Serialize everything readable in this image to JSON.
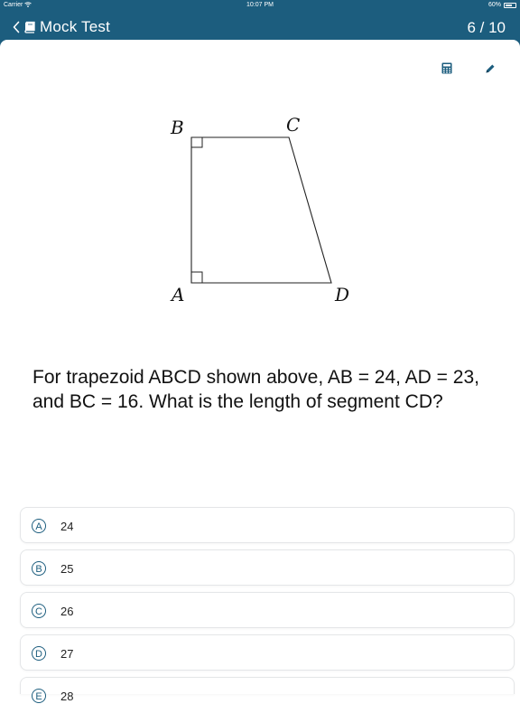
{
  "status": {
    "carrier": "Carrier",
    "time": "10:07 PM",
    "battery": "60%"
  },
  "header": {
    "title": "Mock Test",
    "progress": "6 / 10",
    "color": "#1c5d7e"
  },
  "toolbar": {
    "calculator_icon": "calculator-icon",
    "pencil_icon": "pencil-icon"
  },
  "figure": {
    "labels": {
      "B": "B",
      "C": "C",
      "A": "A",
      "D": "D"
    }
  },
  "question": {
    "text": "For trapezoid ABCD shown above, AB = 24, AD = 23, and BC = 16. What is the length of segment CD?"
  },
  "choices": [
    {
      "letter": "A",
      "text": "24"
    },
    {
      "letter": "B",
      "text": "25"
    },
    {
      "letter": "C",
      "text": "26"
    },
    {
      "letter": "D",
      "text": "27"
    },
    {
      "letter": "E",
      "text": "28"
    }
  ]
}
